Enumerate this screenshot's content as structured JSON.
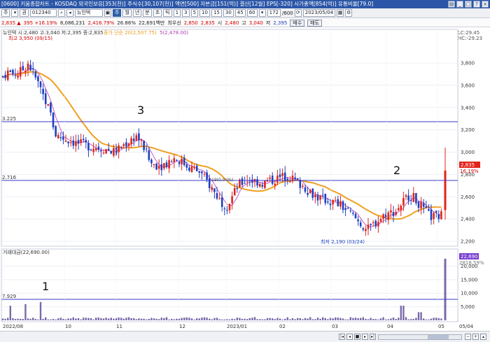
{
  "window": {
    "title": "[0600] 키움종합차트 - KOSDAQ 외국인보유[353(천)] 주식수[30,107(천)] 액면[500] 자본금[151(억)] 결산[12월] EPS[-320] 시가총액[854(억)] 유통비율[79.0]"
  },
  "toolbar": {
    "mode": "주",
    "market": "권",
    "code": "012340",
    "name": "뉴인텍",
    "periods": [
      "주",
      "월",
      "년",
      "분",
      "초",
      "틱"
    ],
    "minutes": [
      "1",
      "3",
      "5",
      "10",
      "15",
      "30",
      "45",
      "60"
    ],
    "count": "172",
    "count_total": "/600",
    "date": "2023/05/04"
  },
  "quote": {
    "price": "2,835 ▲",
    "change": "395 +16.19%",
    "volume": "8,086,231",
    "vol_ratio": "2,416.79%",
    "turnover_ratio": "26.86%",
    "amount": "22,691백만",
    "price_label": "최우선",
    "best": "2,850",
    "best2": "2,835",
    "open_label": "시",
    "open": "2,480",
    "high_label": "고",
    "high": "3,040",
    "low_label": "저",
    "low": "2,395",
    "buy": "매수",
    "sell": "매도"
  },
  "chart_header": {
    "ohlc": "뉴인텍 시:2,480 고:3,040 저:2,395 종:2,835",
    "ma_short": "종가 단순 20(2,507.75)",
    "ma5": "5(2,478.00)",
    "lc": "LC:29.45",
    "hc": "HC:-29.23"
  },
  "annotations": {
    "high_label": "최고 3,950 (09/15)",
    "low_label": "최저 2,190 (03/24)",
    "mark1": "1",
    "mark2": "2",
    "mark3": "3",
    "mid_label": "19(0.00%)"
  },
  "levels": {
    "l3225": "3.225",
    "l2716": "2.716",
    "v7929": "7.929"
  },
  "price_axis": [
    "3,800",
    "3,600",
    "3,400",
    "3,200",
    "3,000",
    "2,800",
    "2,600",
    "2,400",
    "2,200"
  ],
  "price_tags": {
    "price": "2,835",
    "pct": "16.19%"
  },
  "volume_header": "거래대금(22,690.00)",
  "volume_axis": [
    "20,000",
    "15,000",
    "10,000",
    "5,000"
  ],
  "volume_tags": {
    "val": "22,690",
    "pct": "2818.59%"
  },
  "date_axis": [
    "2022/08",
    "10",
    "11",
    "12",
    "2023/01",
    "02",
    "03",
    "04",
    "05",
    "05/04"
  ],
  "colors": {
    "up": "#e2231a",
    "down": "#1f3fbf",
    "ma20": "#f0a020",
    "ma5": "#c45cc4",
    "level": "#3a3ac8"
  }
}
